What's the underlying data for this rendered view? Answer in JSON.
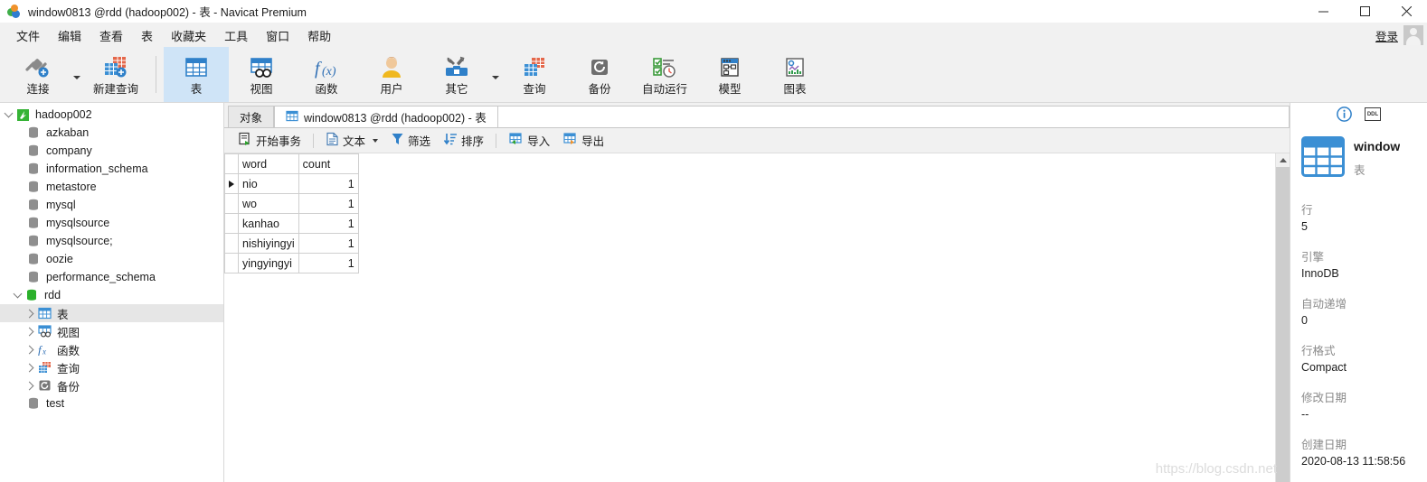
{
  "window": {
    "title": "window0813 @rdd (hadoop002) - 表 - Navicat Premium",
    "logo_icon": "navicat-logo-icon",
    "minimize_icon": "minimize-icon",
    "maximize_icon": "maximize-icon",
    "close_icon": "close-icon"
  },
  "menubar": {
    "items": [
      {
        "label": "文件"
      },
      {
        "label": "编辑"
      },
      {
        "label": "查看"
      },
      {
        "label": "表"
      },
      {
        "label": "收藏夹"
      },
      {
        "label": "工具"
      },
      {
        "label": "窗口"
      },
      {
        "label": "帮助"
      }
    ],
    "login_label": "登录",
    "avatar_icon": "user-avatar-icon"
  },
  "toolbar": {
    "buttons": [
      {
        "label": "连接",
        "icon": "connection-icon",
        "selected": false,
        "has_caret": true
      },
      {
        "label": "新建查询",
        "icon": "new-query-icon",
        "selected": false,
        "has_caret": false
      },
      {
        "label": "表",
        "icon": "table-icon",
        "selected": true,
        "has_caret": false
      },
      {
        "label": "视图",
        "icon": "view-icon",
        "selected": false,
        "has_caret": false
      },
      {
        "label": "函数",
        "icon": "function-icon",
        "selected": false,
        "has_caret": false
      },
      {
        "label": "用户",
        "icon": "user-icon",
        "selected": false,
        "has_caret": false
      },
      {
        "label": "其它",
        "icon": "other-tools-icon",
        "selected": false,
        "has_caret": true
      },
      {
        "label": "查询",
        "icon": "query-icon",
        "selected": false,
        "has_caret": false
      },
      {
        "label": "备份",
        "icon": "backup-icon",
        "selected": false,
        "has_caret": false
      },
      {
        "label": "自动运行",
        "icon": "automation-icon",
        "selected": false,
        "has_caret": false
      },
      {
        "label": "模型",
        "icon": "model-icon",
        "selected": false,
        "has_caret": false
      },
      {
        "label": "图表",
        "icon": "chart-icon",
        "selected": false,
        "has_caret": false
      }
    ]
  },
  "sidebar": {
    "nodes": [
      {
        "label": "hadoop002",
        "indent": 0,
        "twisty": "down",
        "icon": "connection-green-icon",
        "selected": false
      },
      {
        "label": "azkaban",
        "indent": 1,
        "twisty": "none",
        "icon": "database-gray-icon",
        "selected": false
      },
      {
        "label": "company",
        "indent": 1,
        "twisty": "none",
        "icon": "database-gray-icon",
        "selected": false
      },
      {
        "label": "information_schema",
        "indent": 1,
        "twisty": "none",
        "icon": "database-gray-icon",
        "selected": false
      },
      {
        "label": "metastore",
        "indent": 1,
        "twisty": "none",
        "icon": "database-gray-icon",
        "selected": false
      },
      {
        "label": "mysql",
        "indent": 1,
        "twisty": "none",
        "icon": "database-gray-icon",
        "selected": false
      },
      {
        "label": "mysqlsource",
        "indent": 1,
        "twisty": "none",
        "icon": "database-gray-icon",
        "selected": false
      },
      {
        "label": "mysqlsource;",
        "indent": 1,
        "twisty": "none",
        "icon": "database-gray-icon",
        "selected": false
      },
      {
        "label": "oozie",
        "indent": 1,
        "twisty": "none",
        "icon": "database-gray-icon",
        "selected": false
      },
      {
        "label": "performance_schema",
        "indent": 1,
        "twisty": "none",
        "icon": "database-gray-icon",
        "selected": false
      },
      {
        "label": "rdd",
        "indent": 1,
        "twisty": "down",
        "icon": "database-green-icon",
        "selected": false
      },
      {
        "label": "表",
        "indent": 2,
        "twisty": "right",
        "icon": "table-icon",
        "selected": true
      },
      {
        "label": "视图",
        "indent": 2,
        "twisty": "right",
        "icon": "view-icon",
        "selected": false
      },
      {
        "label": "函数",
        "indent": 2,
        "twisty": "right",
        "icon": "function-icon",
        "selected": false
      },
      {
        "label": "查询",
        "indent": 2,
        "twisty": "right",
        "icon": "query-icon",
        "selected": false
      },
      {
        "label": "备份",
        "indent": 2,
        "twisty": "right",
        "icon": "backup-icon",
        "selected": false
      },
      {
        "label": "test",
        "indent": 1,
        "twisty": "none",
        "icon": "database-gray-icon",
        "selected": false
      }
    ]
  },
  "tabs": [
    {
      "label": "对象",
      "icon": "none",
      "active": false
    },
    {
      "label": "window0813 @rdd (hadoop002) - 表",
      "icon": "table-icon",
      "active": true
    }
  ],
  "grid_toolbar": {
    "buttons": [
      {
        "label": "开始事务",
        "icon": "begin-transaction-icon",
        "caret": false
      },
      {
        "label": "文本",
        "icon": "text-icon",
        "caret": true
      },
      {
        "label": "筛选",
        "icon": "filter-icon",
        "caret": false
      },
      {
        "label": "排序",
        "icon": "sort-icon",
        "caret": false
      },
      {
        "label": "导入",
        "icon": "import-icon",
        "caret": false
      },
      {
        "label": "导出",
        "icon": "export-icon",
        "caret": false
      }
    ]
  },
  "grid": {
    "columns": [
      "word",
      "count"
    ],
    "rows": [
      {
        "word": "nio",
        "count": "1",
        "current": true
      },
      {
        "word": "wo",
        "count": "1",
        "current": false
      },
      {
        "word": "kanhao",
        "count": "1",
        "current": false
      },
      {
        "word": "nishiyingyi",
        "count": "1",
        "current": false
      },
      {
        "word": "yingyingyi",
        "count": "1",
        "current": false
      }
    ],
    "selected_cell": {
      "row": 0,
      "column": "word"
    },
    "row_marker_icon": "current-row-arrow-icon",
    "scrollbar_up_icon": "scroll-up-arrow-icon"
  },
  "info_panel": {
    "info_icon": "info-circle-icon",
    "ddl_label": "DDL",
    "object_icon": "table-large-icon",
    "object_name": "window",
    "object_type": "表",
    "properties": [
      {
        "key": "行",
        "value": "5"
      },
      {
        "key": "引擎",
        "value": "InnoDB"
      },
      {
        "key": "自动递增",
        "value": "0"
      },
      {
        "key": "行格式",
        "value": "Compact"
      },
      {
        "key": "修改日期",
        "value": "--"
      },
      {
        "key": "创建日期",
        "value": "2020-08-13 11:58:56"
      }
    ]
  },
  "watermark": {
    "text": "https://blog.csdn.net"
  },
  "colors": {
    "accent": "#0a7ee0",
    "toolbar_bg": "#f1f1f1",
    "selected_toolbar": "#cfe4f7",
    "column_header": "#d9e9f7",
    "tree_selected": "#e6e6e6"
  }
}
